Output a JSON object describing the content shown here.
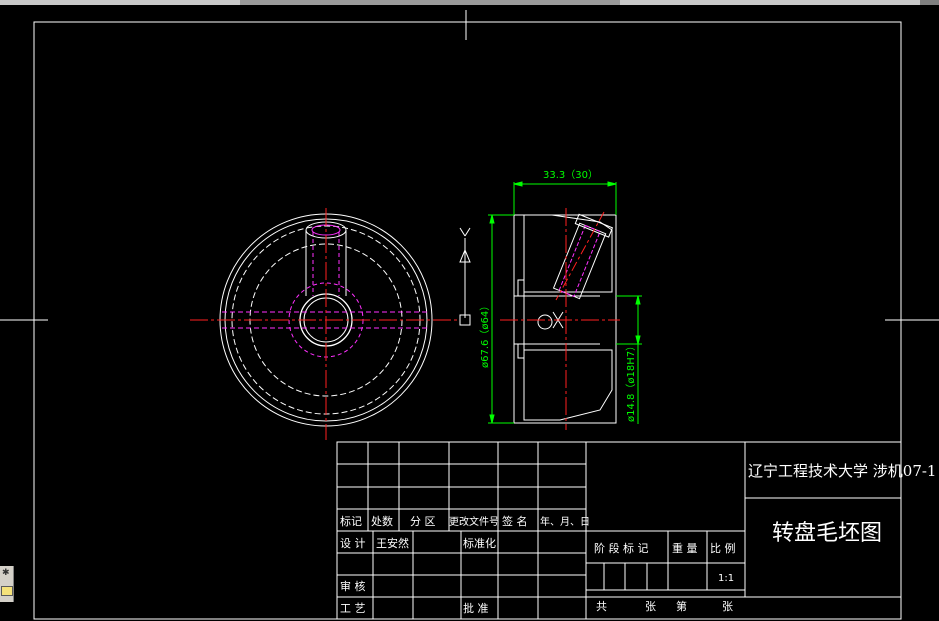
{
  "colors": {
    "background": "#000000",
    "lines": "#ffffff",
    "centerline": "#ff2020",
    "hidden": "#ff30ff",
    "dimension": "#00ff00"
  },
  "dimensions": {
    "width": "33.3（30）",
    "diameter_outer": "ø67.6（ø64）",
    "diameter_bore": "ø14.8（ø18H7）"
  },
  "axis_label": "Y",
  "title_block": {
    "school": "辽宁工程技术大学 涉机07-1",
    "drawing_title": "转盘毛坯图",
    "rev_headers": [
      "标记",
      "处数",
      "分 区",
      "更改文件号",
      "签 名",
      "年、月、日"
    ],
    "design_label": "设 计",
    "designer": "王安然",
    "standardize_label": "标准化",
    "review_label": "审 核",
    "process_label": "工 艺",
    "approve_label": "批 准",
    "stage_label": "阶 段 标 记",
    "weight_label": "重 量",
    "scale_label": "比 例",
    "scale_value": "1:1",
    "total_label": "共",
    "sheet_label": "张",
    "no_label": "第",
    "sheet_label2": "张"
  },
  "icons": [
    "star-icon",
    "folder-icon"
  ]
}
